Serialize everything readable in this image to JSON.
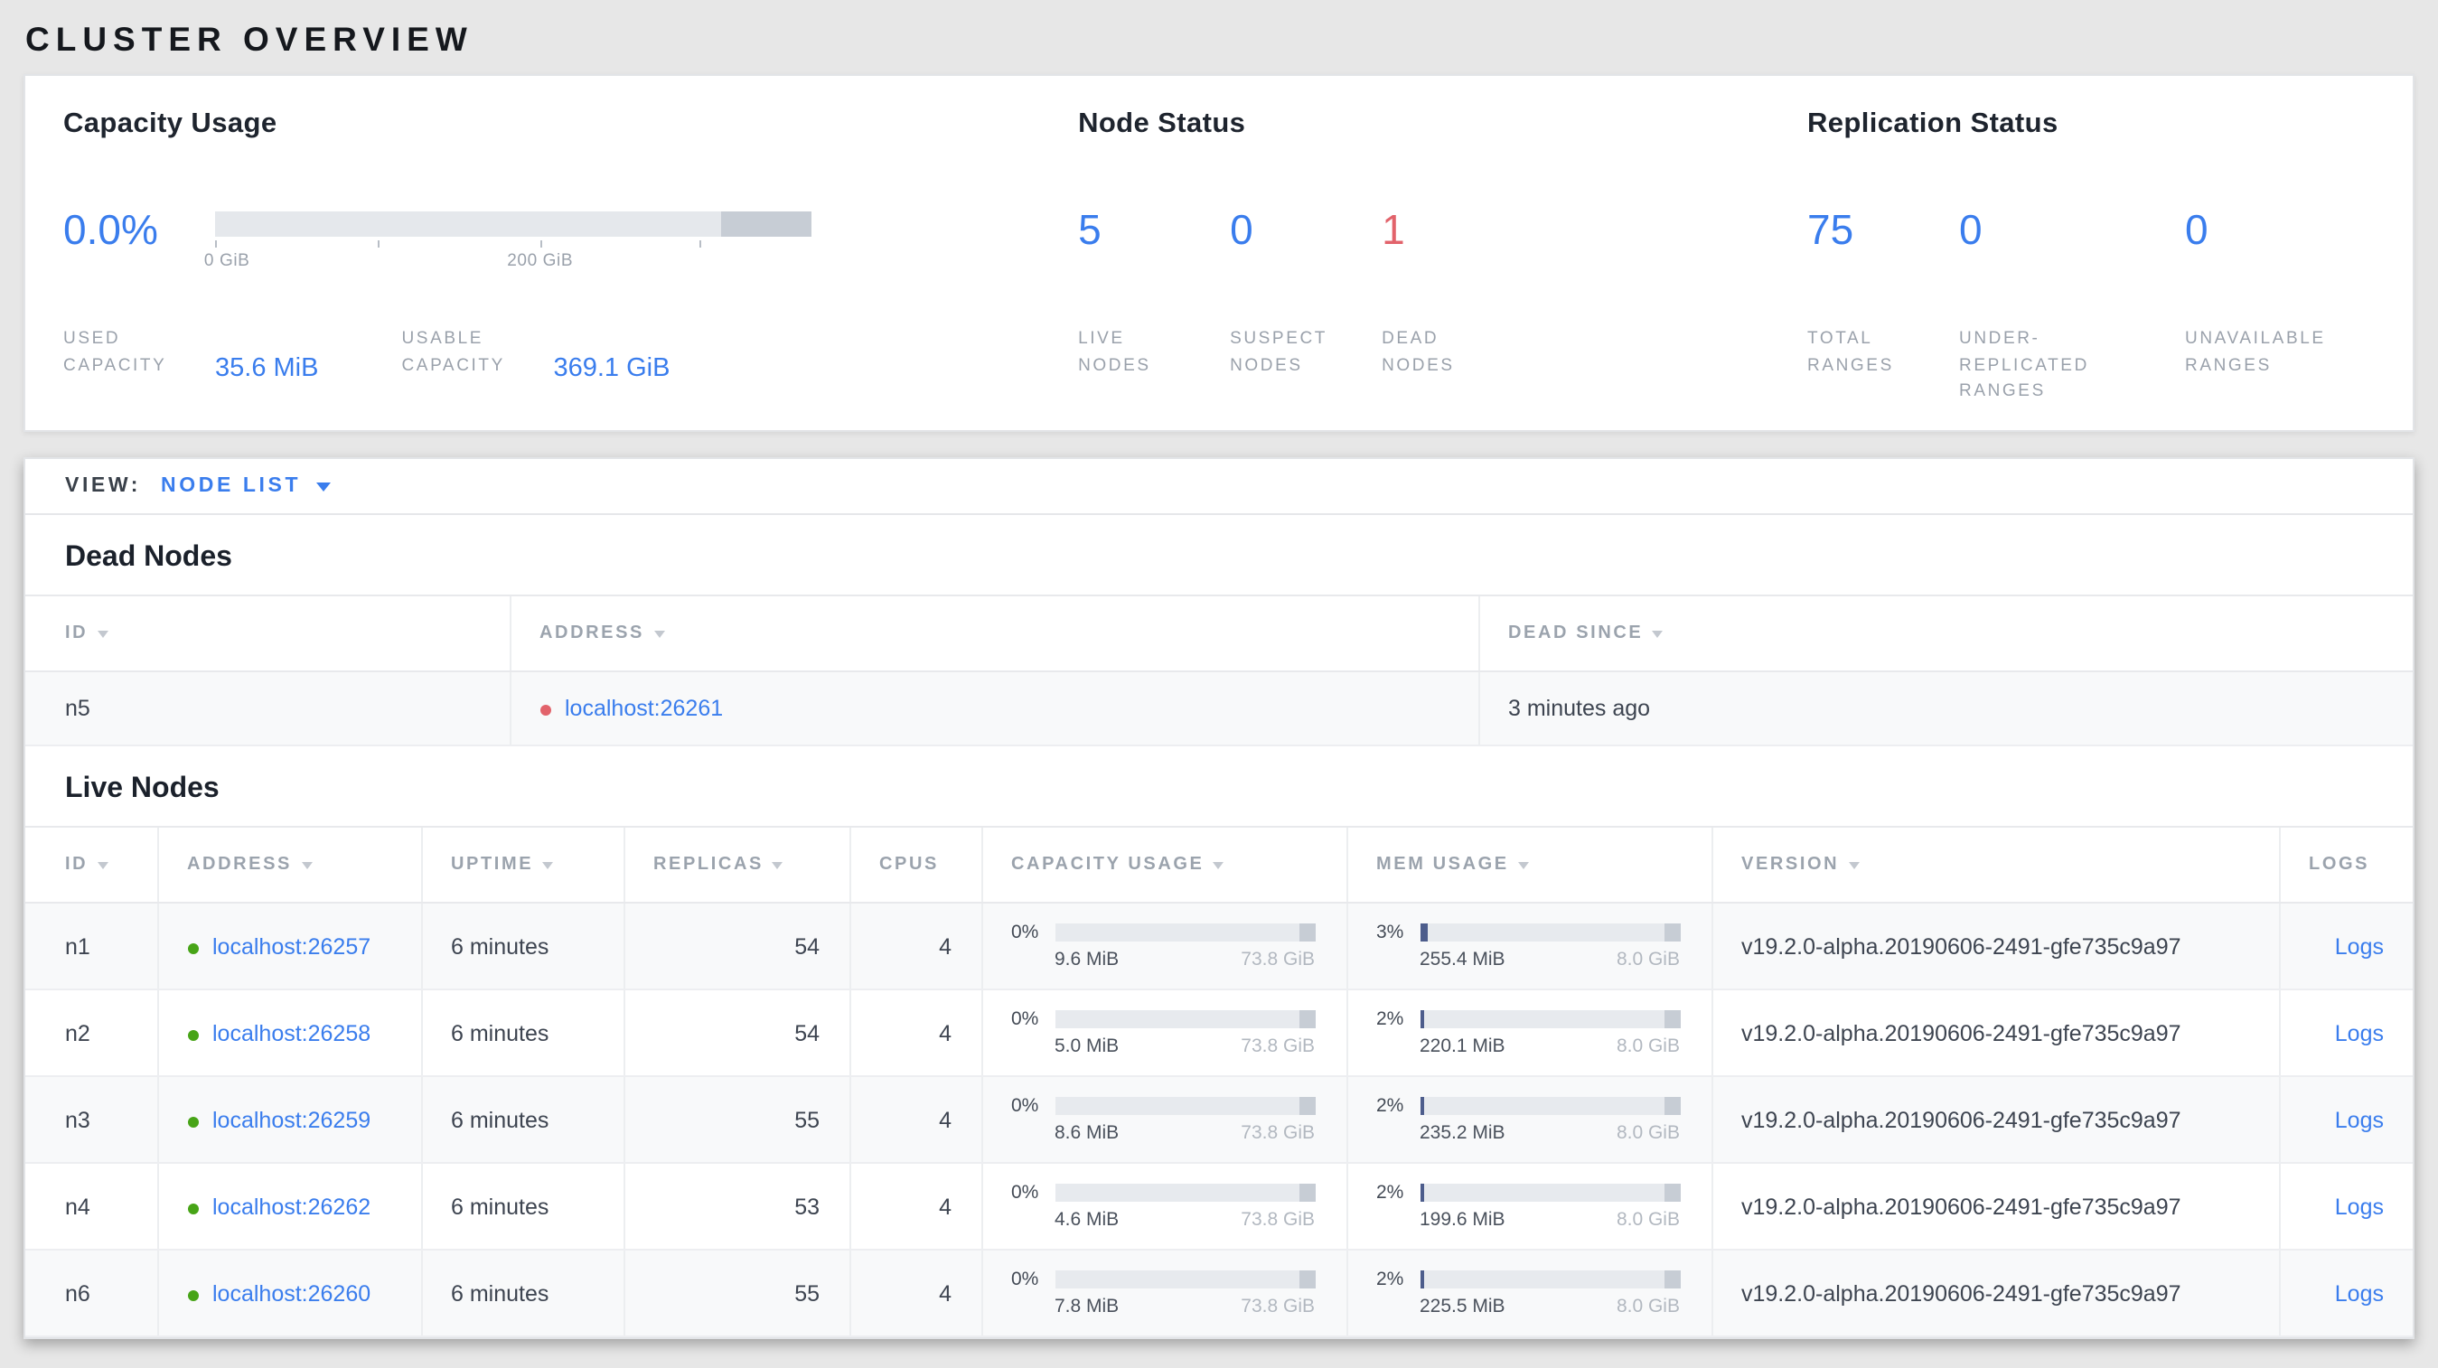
{
  "page_title": "CLUSTER OVERVIEW",
  "colors": {
    "accent_blue": "#3a7ded",
    "status_red": "#e2636b",
    "status_green": "#47a417"
  },
  "summary": {
    "capacity_usage": {
      "heading": "Capacity Usage",
      "percent_used": "0.0%",
      "axis_ticks": [
        "0 GiB",
        "200 GiB"
      ],
      "used": {
        "label": "USED CAPACITY",
        "value": "35.6 MiB"
      },
      "usable": {
        "label": "USABLE CAPACITY",
        "value": "369.1 GiB"
      }
    },
    "node_status": {
      "heading": "Node Status",
      "stats": [
        {
          "value": "5",
          "label": "LIVE NODES"
        },
        {
          "value": "0",
          "label": "SUSPECT NODES"
        },
        {
          "value": "1",
          "label": "DEAD NODES"
        }
      ]
    },
    "replication_status": {
      "heading": "Replication Status",
      "stats": [
        {
          "value": "75",
          "label": "TOTAL RANGES"
        },
        {
          "value": "0",
          "label": "UNDER-REPLICATED RANGES"
        },
        {
          "value": "0",
          "label": "UNAVAILABLE RANGES"
        }
      ]
    }
  },
  "view_bar": {
    "label": "VIEW:",
    "selected_view": "NODE LIST"
  },
  "dead_nodes": {
    "heading": "Dead Nodes",
    "columns": [
      {
        "label": "ID"
      },
      {
        "label": "ADDRESS"
      },
      {
        "label": "DEAD SINCE"
      }
    ],
    "rows": [
      {
        "id": "n5",
        "address": "localhost:26261",
        "dead_since": "3 minutes ago"
      }
    ]
  },
  "live_nodes": {
    "heading": "Live Nodes",
    "columns": [
      {
        "label": "ID"
      },
      {
        "label": "ADDRESS"
      },
      {
        "label": "UPTIME"
      },
      {
        "label": "REPLICAS"
      },
      {
        "label": "CPUS"
      },
      {
        "label": "CAPACITY USAGE"
      },
      {
        "label": "MEM USAGE"
      },
      {
        "label": "VERSION"
      },
      {
        "label": "LOGS"
      }
    ],
    "rows": [
      {
        "id": "n1",
        "address": "localhost:26257",
        "uptime": "6 minutes",
        "replicas": "54",
        "cpus": "4",
        "capacity": {
          "percent": "0%",
          "used": "9.6 MiB",
          "total": "73.8 GiB"
        },
        "memory": {
          "percent": "3%",
          "used": "255.4 MiB",
          "total": "8.0 GiB"
        },
        "version": "v19.2.0-alpha.20190606-2491-gfe735c9a97",
        "logs_label": "Logs"
      },
      {
        "id": "n2",
        "address": "localhost:26258",
        "uptime": "6 minutes",
        "replicas": "54",
        "cpus": "4",
        "capacity": {
          "percent": "0%",
          "used": "5.0 MiB",
          "total": "73.8 GiB"
        },
        "memory": {
          "percent": "2%",
          "used": "220.1 MiB",
          "total": "8.0 GiB"
        },
        "version": "v19.2.0-alpha.20190606-2491-gfe735c9a97",
        "logs_label": "Logs"
      },
      {
        "id": "n3",
        "address": "localhost:26259",
        "uptime": "6 minutes",
        "replicas": "55",
        "cpus": "4",
        "capacity": {
          "percent": "0%",
          "used": "8.6 MiB",
          "total": "73.8 GiB"
        },
        "memory": {
          "percent": "2%",
          "used": "235.2 MiB",
          "total": "8.0 GiB"
        },
        "version": "v19.2.0-alpha.20190606-2491-gfe735c9a97",
        "logs_label": "Logs"
      },
      {
        "id": "n4",
        "address": "localhost:26262",
        "uptime": "6 minutes",
        "replicas": "53",
        "cpus": "4",
        "capacity": {
          "percent": "0%",
          "used": "4.6 MiB",
          "total": "73.8 GiB"
        },
        "memory": {
          "percent": "2%",
          "used": "199.6 MiB",
          "total": "8.0 GiB"
        },
        "version": "v19.2.0-alpha.20190606-2491-gfe735c9a97",
        "logs_label": "Logs"
      },
      {
        "id": "n6",
        "address": "localhost:26260",
        "uptime": "6 minutes",
        "replicas": "55",
        "cpus": "4",
        "capacity": {
          "percent": "0%",
          "used": "7.8 MiB",
          "total": "73.8 GiB"
        },
        "memory": {
          "percent": "2%",
          "used": "225.5 MiB",
          "total": "8.0 GiB"
        },
        "version": "v19.2.0-alpha.20190606-2491-gfe735c9a97",
        "logs_label": "Logs"
      }
    ]
  }
}
